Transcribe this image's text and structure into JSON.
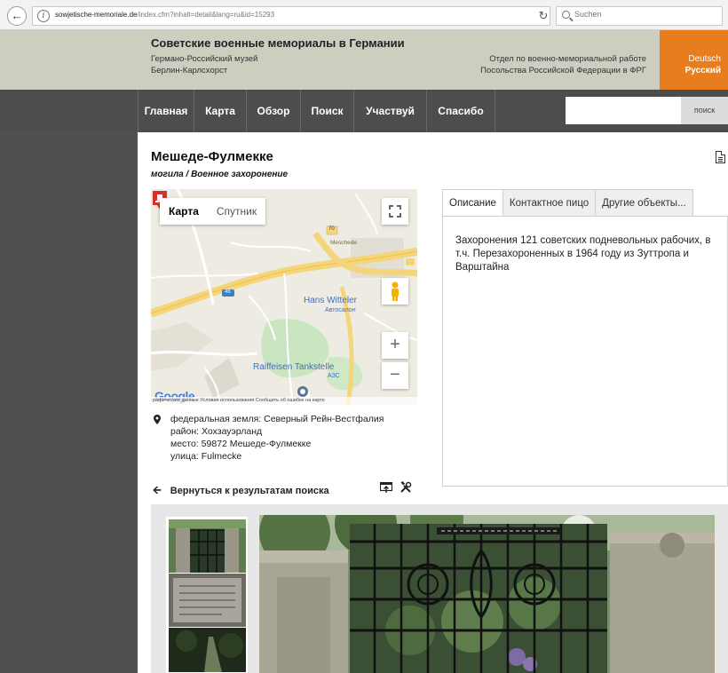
{
  "browser": {
    "url_domain": "sowjetische-memoriale.de",
    "url_path": "/index.cfm?inhalt=detail&lang=ru&id=15293",
    "search_placeholder": "Suchen"
  },
  "header": {
    "title": "Советские военные мемориалы в Германии",
    "subtitle_line1": "Германо-Российский музей",
    "subtitle_line2": "Берлин-Карлсхорст",
    "dept_line1": "Отдел по военно-мемориальной работе",
    "dept_line2": "Посольства Российской Федерации в ФРГ",
    "lang_de": "Deutsch",
    "lang_ru": "Русский",
    "colors": {
      "accent": "#e87d1e",
      "nav": "#4d4d4d",
      "header_bg": "#cdcdc0"
    }
  },
  "nav": {
    "items": [
      "Главная",
      "Карта",
      "Обзор",
      "Поиск",
      "Участвуй",
      "Спасибо"
    ],
    "search_button": "поиск"
  },
  "page": {
    "title": "Мешеде-Фулмекке",
    "subtitle": "могила / Военное захоронение"
  },
  "map": {
    "tab_map": "Карта",
    "tab_satellite": "Спутник",
    "label_road": "70",
    "label_meschede": "Meschede",
    "label_46": "46",
    "label_hans": "Hans Witteler",
    "label_hans_sub": "Автосалон",
    "label_raiffeisen": "Raiffeisen Tankstelle",
    "label_azs": "АЗС",
    "label_google": "Google",
    "footer": "рафические данные   Условия использования   Сообщить об ошибке на карте"
  },
  "tabs": {
    "items": [
      "Описание",
      "Контактное пицо",
      "Другие объекты..."
    ],
    "description": "Захоронения 121 советских подневольных рабочих, в т.ч. Перезахороненных в 1964 году из Зуттропа и Варштайна"
  },
  "address": {
    "region": "федеральная земля: Северный Рейн-Вестфалия",
    "district": "район: Хохзауэрланд",
    "place": "место: 59872 Мешеде-Фулмекке",
    "street": "улица: Fulmecke"
  },
  "back": {
    "label": "Вернуться к результатам поиска"
  }
}
